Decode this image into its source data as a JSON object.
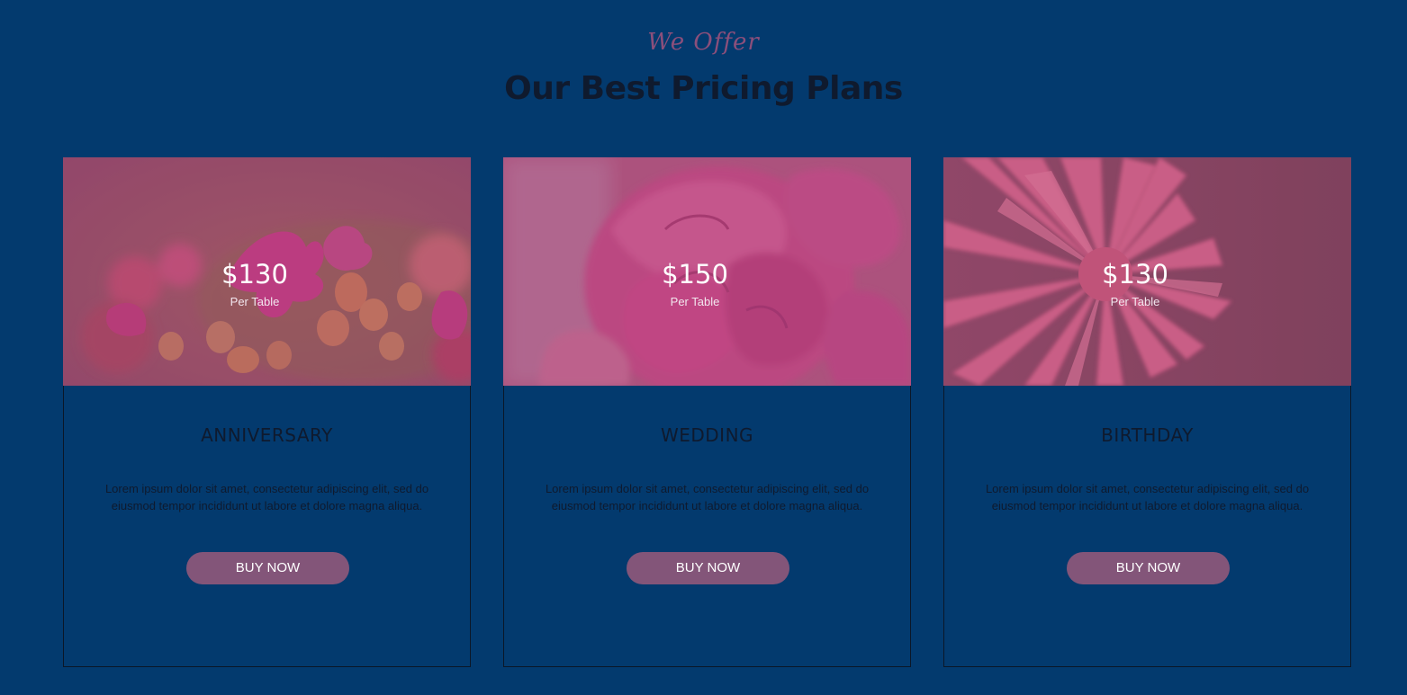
{
  "section": {
    "eyebrow": "We Offer",
    "title": "Our Best Pricing Plans"
  },
  "plans": [
    {
      "price": "$130",
      "unit": "Per Table",
      "name": "ANNIVERSARY",
      "description": "Lorem ipsum dolor sit amet, consectetur adipiscing elit, sed do eiusmod tempor incididunt ut labore et dolore magna aliqua.",
      "button_label": "BUY NOW",
      "image": "pink-flower-buds-photo"
    },
    {
      "price": "$150",
      "unit": "Per Table",
      "name": "WEDDING",
      "description": "Lorem ipsum dolor sit amet, consectetur adipiscing elit, sed do eiusmod tempor incididunt ut labore et dolore magna aliqua.",
      "button_label": "BUY NOW",
      "image": "pink-rose-photo"
    },
    {
      "price": "$130",
      "unit": "Per Table",
      "name": "BIRTHDAY",
      "description": "Lorem ipsum dolor sit amet, consectetur adipiscing elit, sed do eiusmod tempor incididunt ut labore et dolore magna aliqua.",
      "button_label": "BUY NOW",
      "image": "pink-gerbera-photo"
    }
  ],
  "colors": {
    "background": "#033a6e",
    "accent": "#835579",
    "heading": "#0f1a2e",
    "eyebrow": "#8b4f7b"
  }
}
